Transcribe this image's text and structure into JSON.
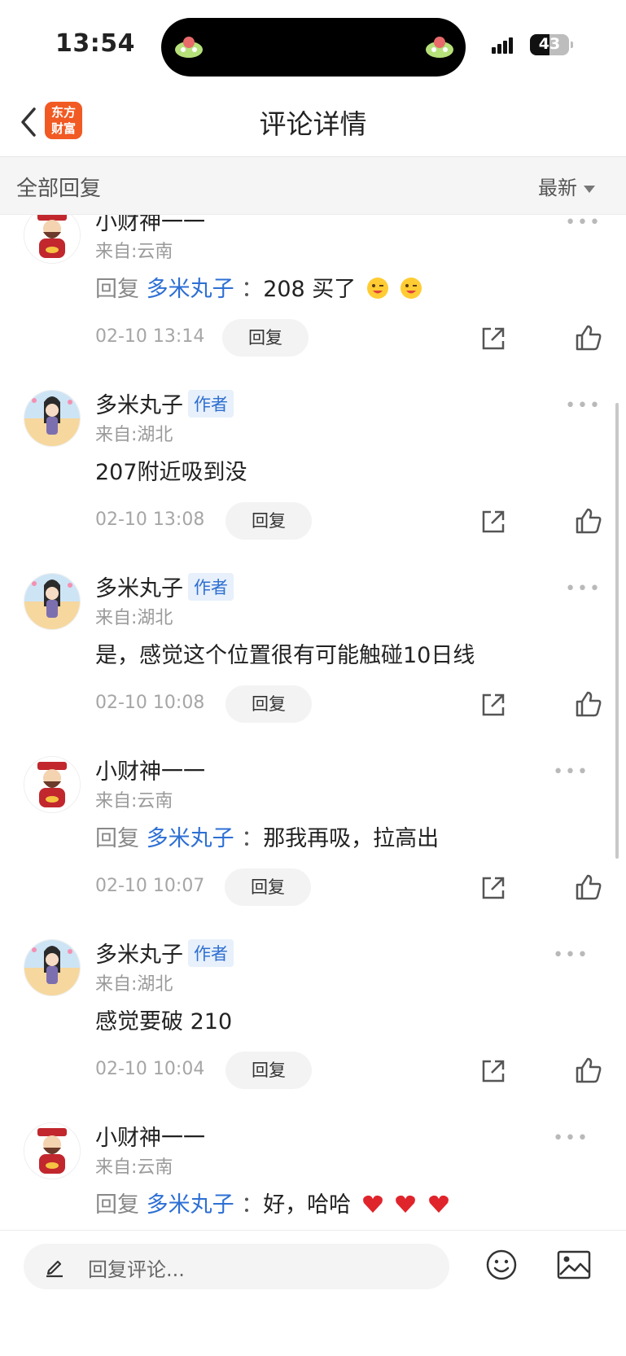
{
  "status_bar": {
    "time": "13:54",
    "battery": "43"
  },
  "header": {
    "title": "评论详情",
    "logo_line1": "东方",
    "logo_line2": "财富"
  },
  "filter": {
    "left_label": "全部回复",
    "sort_label": "最新"
  },
  "comments": [
    {
      "name": "小财神一一",
      "is_author": false,
      "origin": "来自:云南",
      "reply_prefix": "回复",
      "reply_to": "多米丸子",
      "separator": "：",
      "text": "208 买了",
      "emojis": [
        "wink",
        "wink"
      ],
      "time": "02-10 13:14",
      "reply_label": "回复"
    },
    {
      "name": "多米丸子",
      "is_author": true,
      "author_badge": "作者",
      "origin": "来自:湖北",
      "text": "207附近吸到没",
      "emojis": [],
      "time": "02-10 13:08",
      "reply_label": "回复"
    },
    {
      "name": "多米丸子",
      "is_author": true,
      "author_badge": "作者",
      "origin": "来自:湖北",
      "text": "是，感觉这个位置很有可能触碰10日线",
      "emojis": [],
      "time": "02-10 10:08",
      "reply_label": "回复"
    },
    {
      "name": "小财神一一",
      "is_author": false,
      "origin": "来自:云南",
      "reply_prefix": "回复",
      "reply_to": "多米丸子",
      "separator": "：",
      "text": "那我再吸，拉高出",
      "emojis": [],
      "time": "02-10 10:07",
      "reply_label": "回复"
    },
    {
      "name": "多米丸子",
      "is_author": true,
      "author_badge": "作者",
      "origin": "来自:湖北",
      "text": "感觉要破 210",
      "emojis": [],
      "time": "02-10 10:04",
      "reply_label": "回复"
    },
    {
      "name": "小财神一一",
      "is_author": false,
      "origin": "来自:云南",
      "reply_prefix": "回复",
      "reply_to": "多米丸子",
      "separator": "：",
      "text": "好，哈哈",
      "emojis": [
        "heart",
        "heart",
        "heart"
      ],
      "time": "",
      "reply_label": ""
    }
  ],
  "bottom_bar": {
    "placeholder": "回复评论..."
  },
  "icons": {
    "back": "chevron-left-icon",
    "more": "more-dots-icon",
    "share": "share-icon",
    "like": "thumbs-up-icon",
    "pen": "pen-icon",
    "emoji": "emoji-icon",
    "image": "image-icon"
  },
  "colors": {
    "accent_blue": "#2d6fd4",
    "logo_orange": "#f15a22",
    "badge_bg": "#e7f0fb"
  }
}
